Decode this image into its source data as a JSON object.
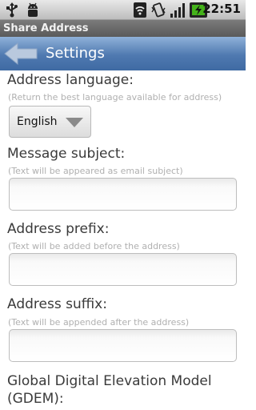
{
  "status_bar": {
    "time": "22:51",
    "icons": [
      "usb-icon",
      "android-debug-icon",
      "wifi-icon",
      "vibrate-icon",
      "signal-icon",
      "battery-icon"
    ]
  },
  "app": {
    "title": "Share Address"
  },
  "header": {
    "title": "Settings"
  },
  "settings": {
    "language": {
      "label": "Address language:",
      "hint": "(Return the best language available for address)",
      "selected": "English"
    },
    "subject": {
      "label": "Message subject:",
      "hint": "(Text will be appeared as email subject)",
      "value": ""
    },
    "prefix": {
      "label": "Address prefix:",
      "hint": "(Text will be added before the address)",
      "value": ""
    },
    "suffix": {
      "label": "Address suffix:",
      "hint": "(Text will be appended after the address)",
      "value": ""
    },
    "gdem": {
      "label_line1": "Global Digital Elevation Model",
      "label_line2": "(GDEM):"
    }
  },
  "colors": {
    "header_blue": "#4f79b0",
    "title_gray": "#5a5a5a",
    "battery_green": "#44b21a"
  }
}
